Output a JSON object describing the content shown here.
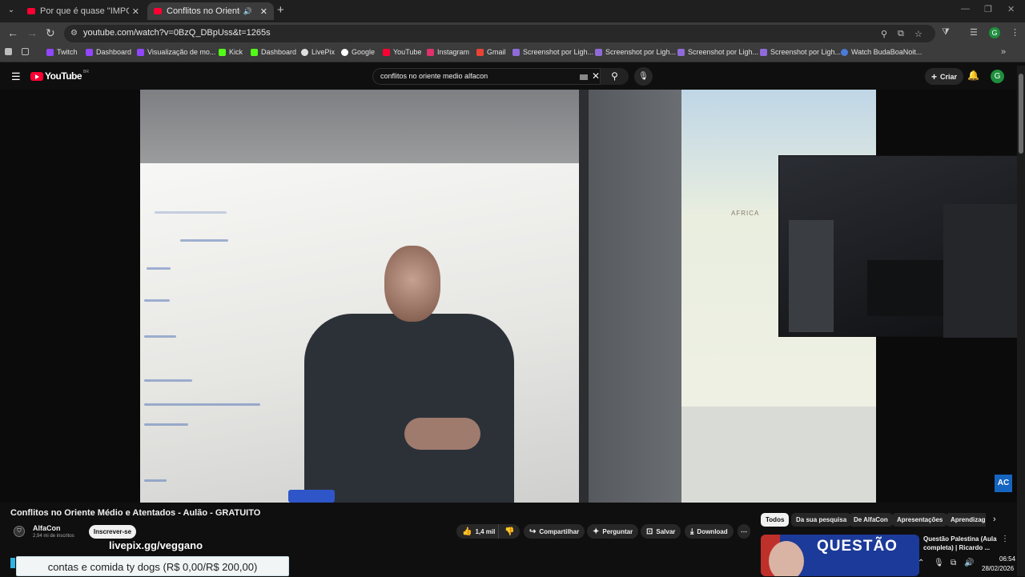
{
  "browser": {
    "tabs": [
      {
        "title": "Por que é quase \"IMPOSSÍVEL\"",
        "close": "✕"
      },
      {
        "title": "Conflitos no Oriente Médio",
        "close": "✕",
        "audio": "🔊"
      }
    ],
    "new_tab": "+",
    "menu_glyph": "⌄",
    "window_controls": [
      "—",
      "❐",
      "✕"
    ],
    "nav": {
      "back": "←",
      "forward": "→",
      "reload": "↻"
    },
    "url": "youtube.com/watch?v=0BzQ_DBpUss&t=1265s",
    "omnibox_icons": {
      "site_info": "⚙",
      "zoom": "⚲",
      "install": "⧉",
      "bookmark": "☆"
    },
    "toolbar_icons": {
      "extensions": "⧩",
      "reading": "☰",
      "menu": "⋮"
    },
    "profile_initial": "G",
    "bookmarks": [
      {
        "label": "",
        "color": "#bdbdbd"
      },
      {
        "label": "",
        "color": "#bdbdbd"
      },
      {
        "label": "Twitch",
        "color": "#9146ff"
      },
      {
        "label": "Dashboard",
        "color": "#9146ff"
      },
      {
        "label": "Visualização de mo...",
        "color": "#9146ff"
      },
      {
        "label": "Kick",
        "color": "#53fc18"
      },
      {
        "label": "Dashboard",
        "color": "#53fc18"
      },
      {
        "label": "LivePix",
        "color": "#e0e0e0"
      },
      {
        "label": "Google",
        "color": "#ffffff"
      },
      {
        "label": "YouTube",
        "color": "#ff0033"
      },
      {
        "label": "Instagram",
        "color": "#e1306c"
      },
      {
        "label": "Gmail",
        "color": "#ea4335"
      },
      {
        "label": "Screenshot por Ligh...",
        "color": "#8e6bd8"
      },
      {
        "label": "Screenshot por Ligh...",
        "color": "#8e6bd8"
      },
      {
        "label": "Screenshot por Ligh...",
        "color": "#8e6bd8"
      },
      {
        "label": "Screenshot por Ligh...",
        "color": "#8e6bd8"
      },
      {
        "label": "Watch BudaBoaNoit...",
        "color": "#4a7bd8"
      }
    ],
    "bookmarks_more": "»"
  },
  "youtube": {
    "logo_text": "YouTube",
    "logo_country": "BR",
    "menu_glyph": "☰",
    "search_query": "conflitos no oriente medio alfacon",
    "search_clear": "✕",
    "search_glyph": "⚲",
    "mic_glyph": "🎙",
    "create_label": "Criar",
    "create_glyph": "+",
    "bell_glyph": "🔔",
    "avatar_initial": "G"
  },
  "player": {
    "board_label": "AFRICA",
    "channel_logo": "AC"
  },
  "video": {
    "title": "Conflitos no Oriente Médio e Atentados - Aulão - GRATUITO",
    "channel": "AlfaCon",
    "subscribers": "2,94 mi de inscritos",
    "subscribe_label": "Inscrever-se",
    "likes": "1,4 mil",
    "like_glyph": "👍",
    "dislike_glyph": "👎",
    "share_label": "Compartilhar",
    "share_glyph": "↪",
    "ask_label": "Perguntar",
    "ask_glyph": "✦",
    "save_label": "Salvar",
    "save_glyph": "⊡",
    "download_label": "Download",
    "download_glyph": "⤓",
    "more_glyph": "⋯"
  },
  "sidebar": {
    "chips": [
      "Todos",
      "Da sua pesquisa",
      "De AlfaCon",
      "Apresentações",
      "Aprendizag"
    ],
    "chip_next": "›",
    "recommendation": {
      "thumb_text": "QUESTÃO",
      "title": "Questão Palestina (Aula completa) | Ricardo ...",
      "more": "⋮"
    }
  },
  "overlay": {
    "livepix_url": "livepix.gg/veggano",
    "donation_text": "contas e comida ty dogs (R$ 0,00/R$ 200,00)",
    "donation_progress": 0
  },
  "taskbar": {
    "tray_icons": [
      "⌃",
      "🎙",
      "⧉",
      "🔊"
    ],
    "time": "06:54",
    "date": "28/02/2026"
  }
}
